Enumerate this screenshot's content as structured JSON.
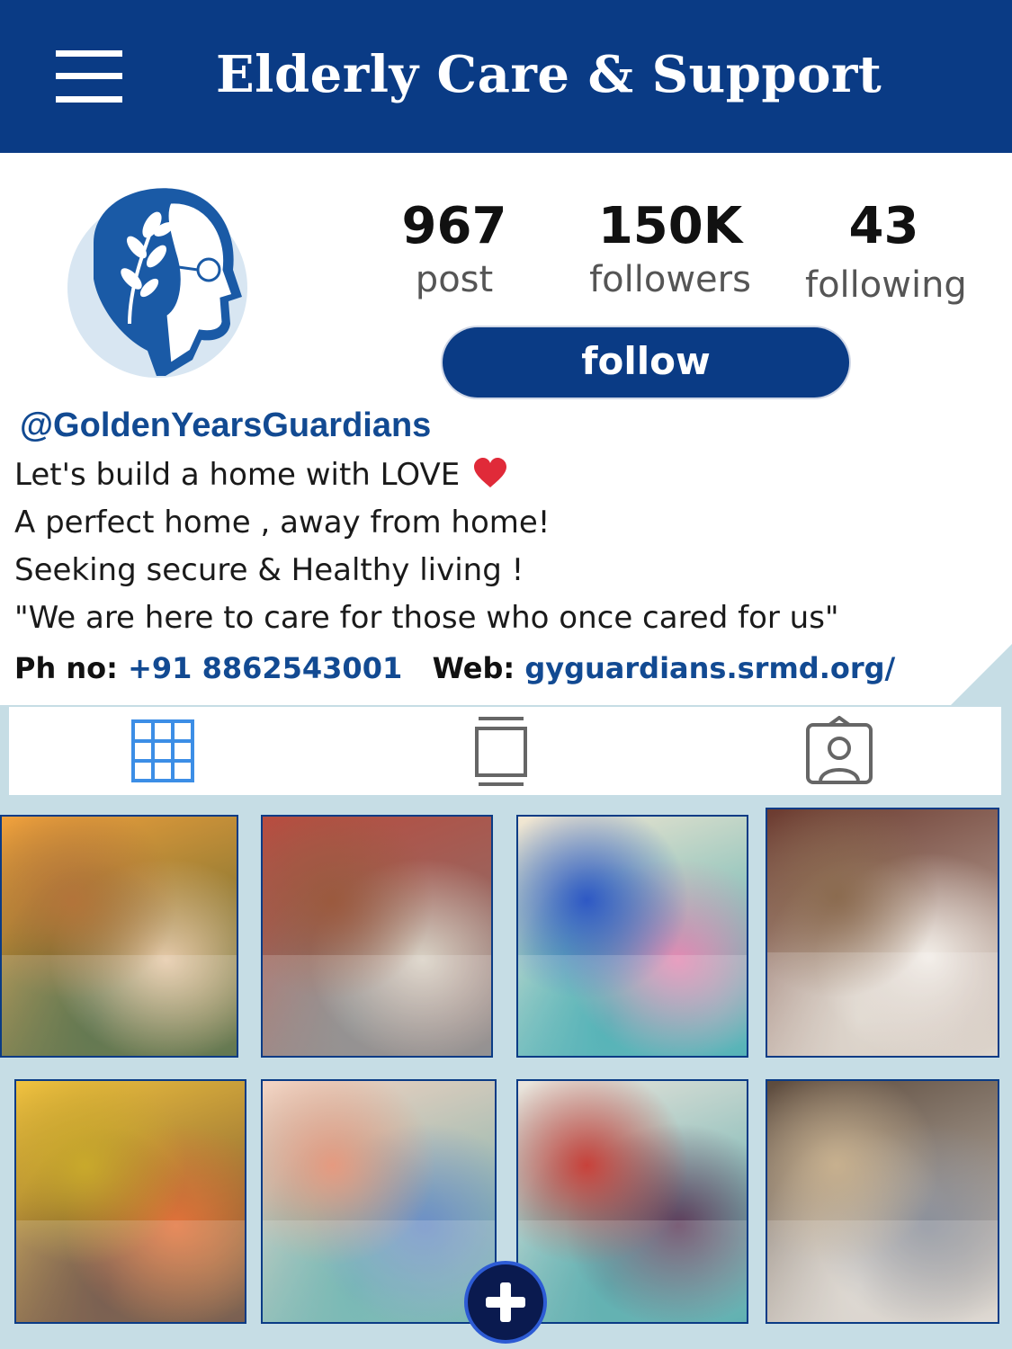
{
  "header": {
    "title": "Elderly Care & Support",
    "menu_icon": "hamburger-menu-icon"
  },
  "profile": {
    "avatar_icon": "elderly-man-tree-logo",
    "stats": [
      {
        "value": "967",
        "label": "post"
      },
      {
        "value": "150K",
        "label": "followers"
      },
      {
        "value": "43",
        "label": "following"
      }
    ],
    "follow_label": "follow",
    "handle": "@GoldenYearsGuardians",
    "bio": [
      "Let's build a home with LOVE",
      "A perfect home , away from home!",
      "Seeking secure & Healthy living !",
      "\"We are here to care for those who once cared for us\""
    ],
    "heart_icon": "red-heart-icon",
    "phone_label": "Ph no:",
    "phone": "+91 8862543001",
    "web_label": "Web:",
    "web": "gyguardians.srmd.org/"
  },
  "tabs": [
    {
      "name": "posts-grid",
      "icon": "grid-icon"
    },
    {
      "name": "reels",
      "icon": "stacked-frames-icon"
    },
    {
      "name": "tagged",
      "icon": "tagged-person-icon"
    }
  ],
  "photos": [
    {
      "name": "photo-women-bedroom",
      "colors": [
        "#b3743a",
        "#e6c9a8",
        "#3f5a2c",
        "#f0a03c"
      ]
    },
    {
      "name": "photo-group-exercise",
      "colors": [
        "#9b5a3e",
        "#d9d1c4",
        "#7c7c7c",
        "#b84c3f"
      ]
    },
    {
      "name": "photo-women-sarees",
      "colors": [
        "#2e58c4",
        "#e38ab3",
        "#2fa2a8",
        "#f4e7d2"
      ]
    },
    {
      "name": "photo-elderly-group",
      "colors": [
        "#8b6b4f",
        "#f1ece6",
        "#d8cfc4",
        "#6b3a2f"
      ]
    },
    {
      "name": "photo-women-eating",
      "colors": [
        "#c9a92b",
        "#e2723a",
        "#5b3b2b",
        "#f0c23f"
      ]
    },
    {
      "name": "photo-two-women",
      "colors": [
        "#e59a80",
        "#6d8fc6",
        "#5aa9a5",
        "#f4d3c2"
      ]
    },
    {
      "name": "photo-women-doorway",
      "colors": [
        "#c8413a",
        "#5e3c5a",
        "#3d9fa0",
        "#ece5dc"
      ]
    },
    {
      "name": "photo-man-serving",
      "colors": [
        "#c7b08e",
        "#8a8f9a",
        "#d9d3cb",
        "#5c4a3c"
      ]
    }
  ],
  "fab_icon": "add-plus-icon"
}
